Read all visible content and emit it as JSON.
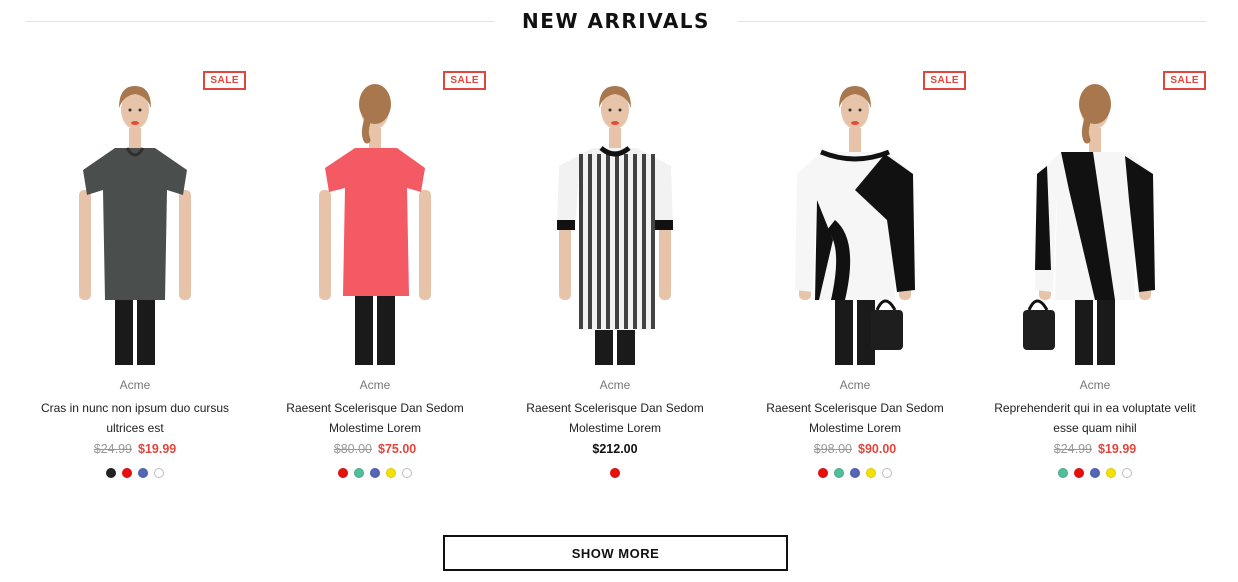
{
  "section": {
    "title": "NEW ARRIVALS"
  },
  "products": [
    {
      "brand": "Acme",
      "title": "Cras in nunc non ipsum duo cursus ultrices est",
      "old_price": "$24.99",
      "price": "$19.99",
      "sale": true,
      "sale_label": "SALE",
      "swatches": [
        "#222222",
        "#e8100f",
        "#5468b8",
        "#ffffff"
      ],
      "outfit": "grey-tee"
    },
    {
      "brand": "Acme",
      "title": "Raesent Scelerisque Dan Sedom Molestime Lorem",
      "old_price": "$80.00",
      "price": "$75.00",
      "sale": true,
      "sale_label": "SALE",
      "swatches": [
        "#e8100f",
        "#4fbf97",
        "#5468b8",
        "#f5e104",
        "#ffffff"
      ],
      "outfit": "pink-tee"
    },
    {
      "brand": "Acme",
      "title": "Raesent Scelerisque Dan Sedom Molestime Lorem",
      "old_price": "",
      "price": "$212.00",
      "sale": false,
      "sale_label": "",
      "swatches": [
        "#e8100f"
      ],
      "outfit": "print-dress"
    },
    {
      "brand": "Acme",
      "title": "Raesent Scelerisque Dan Sedom Molestime Lorem",
      "old_price": "$98.00",
      "price": "$90.00",
      "sale": true,
      "sale_label": "SALE",
      "swatches": [
        "#e8100f",
        "#4fbf97",
        "#5468b8",
        "#f5e104",
        "#ffffff"
      ],
      "outfit": "bw-sweater-front"
    },
    {
      "brand": "Acme",
      "title": "Reprehenderit qui in ea voluptate velit esse quam nihil",
      "old_price": "$24.99",
      "price": "$19.99",
      "sale": true,
      "sale_label": "SALE",
      "swatches": [
        "#4fbf97",
        "#e8100f",
        "#5468b8",
        "#f5e104",
        "#ffffff"
      ],
      "outfit": "bw-sweater-back"
    }
  ],
  "show_more": {
    "label": "SHOW MORE"
  },
  "colors": {
    "accent": "#e2453c",
    "text": "#222222"
  }
}
